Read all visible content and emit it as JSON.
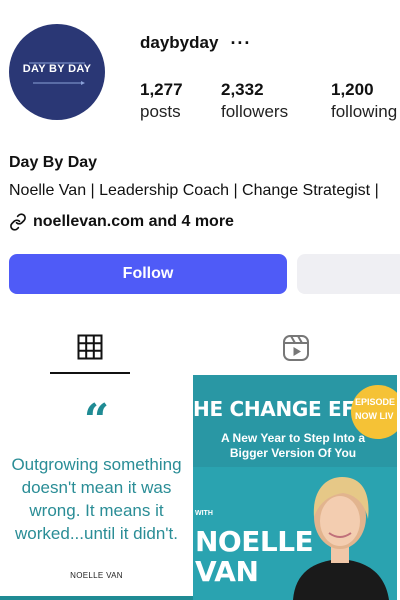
{
  "profile": {
    "avatar_text": "DAY BY DAY",
    "username": "daybyday",
    "more_icon": "ellipsis-icon",
    "stats": [
      {
        "value": "1,277",
        "label": "posts"
      },
      {
        "value": "2,332",
        "label": "followers"
      },
      {
        "value": "1,200",
        "label": "following"
      }
    ],
    "display_name": "Day By Day",
    "bio": "Noelle Van | Leadership Coach | Change Strategist | ",
    "link_text": "noellevan.com and 4 more"
  },
  "actions": {
    "follow_label": "Follow",
    "follow_color": "#4f5bf7"
  },
  "tabs": [
    {
      "name": "posts-grid",
      "icon": "grid-icon",
      "active": true
    },
    {
      "name": "reels",
      "icon": "reels-icon",
      "active": false
    }
  ],
  "posts": {
    "quote": {
      "mark": "“",
      "text_lines": [
        "Outgrowing something",
        "doesn't mean it was",
        "wrong. It means it",
        "worked...until it didn't."
      ],
      "author": "NOELLE VAN"
    },
    "promo": {
      "headline": "HE CHANGE EFFECT",
      "subtitle_lines": [
        "A New Year to Step Into a",
        "Bigger Version Of You"
      ],
      "with": "WITH",
      "name_lines": [
        "NOELLE",
        "VAN"
      ],
      "badge_lines": [
        "EPISODE",
        "NOW LIV"
      ]
    }
  }
}
